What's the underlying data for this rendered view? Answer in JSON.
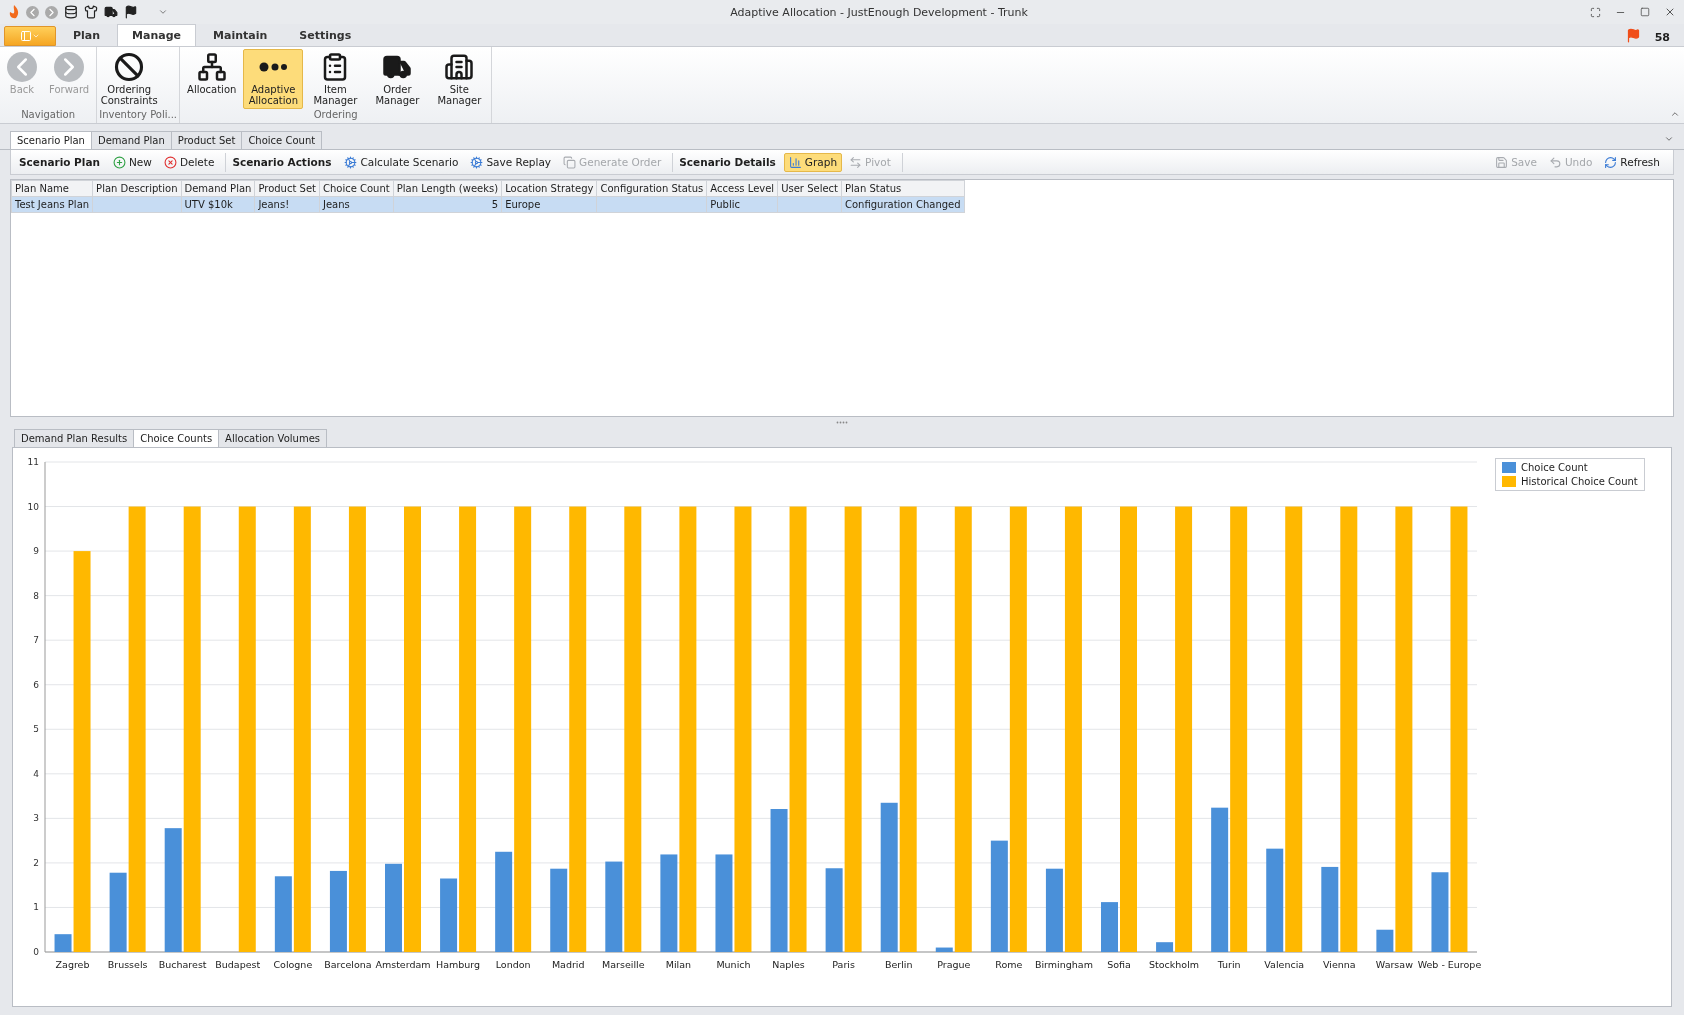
{
  "window": {
    "title": "Adaptive Allocation - JustEnough Development - Trunk"
  },
  "ribbon": {
    "tabs": [
      {
        "label": "Plan",
        "selected": false
      },
      {
        "label": "Manage",
        "selected": true
      },
      {
        "label": "Maintain",
        "selected": false
      },
      {
        "label": "Settings",
        "selected": false
      }
    ],
    "notification_count": "58",
    "groups": [
      {
        "label": "Navigation",
        "buttons": [
          {
            "label": "Back",
            "kind": "back",
            "disabled": true,
            "selected": false
          },
          {
            "label": "Forward",
            "kind": "forward",
            "disabled": true,
            "selected": false
          }
        ]
      },
      {
        "label": "Inventory Poli...",
        "buttons": [
          {
            "label": "Ordering Constraints",
            "kind": "ban",
            "disabled": false,
            "selected": false
          }
        ]
      },
      {
        "label": "Ordering",
        "buttons": [
          {
            "label": "Allocation",
            "kind": "tree",
            "disabled": false,
            "selected": false
          },
          {
            "label": "Adaptive Allocation",
            "kind": "dots",
            "disabled": false,
            "selected": true
          },
          {
            "label": "Item Manager",
            "kind": "notepad",
            "disabled": false,
            "selected": false
          },
          {
            "label": "Order Manager",
            "kind": "truck",
            "disabled": false,
            "selected": false
          },
          {
            "label": "Site Manager",
            "kind": "building",
            "disabled": false,
            "selected": false
          }
        ]
      }
    ]
  },
  "document_tabs": [
    {
      "label": "Scenario Plan",
      "selected": true
    },
    {
      "label": "Demand Plan",
      "selected": false
    },
    {
      "label": "Product Set",
      "selected": false
    },
    {
      "label": "Choice Count",
      "selected": false
    }
  ],
  "toolbar": {
    "groups": [
      {
        "heading": "Scenario Plan",
        "buttons": [
          {
            "label": "New",
            "kind": "plus",
            "disabled": false,
            "selected": false
          },
          {
            "label": "Delete",
            "kind": "delete",
            "disabled": false,
            "selected": false
          }
        ]
      },
      {
        "heading": "Scenario Actions",
        "buttons": [
          {
            "label": "Calculate Scenario",
            "kind": "gears",
            "disabled": false,
            "selected": false
          },
          {
            "label": "Save Replay",
            "kind": "gears",
            "disabled": false,
            "selected": false
          },
          {
            "label": "Generate Order",
            "kind": "copy",
            "disabled": true,
            "selected": false
          }
        ]
      },
      {
        "heading": "Scenario Details",
        "buttons": [
          {
            "label": "Graph",
            "kind": "chart",
            "disabled": false,
            "selected": true
          },
          {
            "label": "Pivot",
            "kind": "swap",
            "disabled": true,
            "selected": false
          }
        ]
      }
    ],
    "right_buttons": [
      {
        "label": "Save",
        "kind": "save",
        "disabled": true,
        "selected": false
      },
      {
        "label": "Undo",
        "kind": "undo",
        "disabled": true,
        "selected": false
      },
      {
        "label": "Refresh",
        "kind": "refresh",
        "disabled": false,
        "selected": false
      }
    ]
  },
  "table": {
    "columns": [
      "Plan Name",
      "Plan Description",
      "Demand Plan",
      "Product Set",
      "Choice Count",
      "Plan Length (weeks)",
      "Location Strategy",
      "Configuration Status",
      "Access Level",
      "User Select",
      "Plan Status"
    ],
    "rows": [
      {
        "selected": true,
        "cells": [
          "Test Jeans Plan",
          "",
          "UTV $10k",
          "Jeans!",
          "Jeans",
          "5",
          "Europe",
          "",
          "Public",
          "",
          "Configuration Changed"
        ]
      }
    ]
  },
  "result_tabs": [
    {
      "label": "Demand Plan Results",
      "selected": false
    },
    {
      "label": "Choice Counts",
      "selected": true
    },
    {
      "label": "Allocation Volumes",
      "selected": false
    }
  ],
  "chart_data": {
    "type": "bar",
    "grid": true,
    "categories": [
      "Zagreb",
      "Brussels",
      "Bucharest",
      "Budapest",
      "Cologne",
      "Barcelona",
      "Amsterdam",
      "Hamburg",
      "London",
      "Madrid",
      "Marseille",
      "Milan",
      "Munich",
      "Naples",
      "Paris",
      "Berlin",
      "Prague",
      "Rome",
      "Birmingham",
      "Sofia",
      "Stockholm",
      "Turin",
      "Valencia",
      "Vienna",
      "Warsaw",
      "Web - Europe"
    ],
    "series": [
      {
        "name": "Choice Count",
        "color": "#4a90d9",
        "values": [
          0.4,
          1.78,
          2.78,
          0,
          1.7,
          1.82,
          1.98,
          1.65,
          2.25,
          1.87,
          2.03,
          2.19,
          2.19,
          3.21,
          1.88,
          3.35,
          0.1,
          2.5,
          1.87,
          1.12,
          0.22,
          3.24,
          2.32,
          1.91,
          0.5,
          1.79
        ]
      },
      {
        "name": "Historical Choice Count",
        "color": "#ffb800",
        "values": [
          9,
          10,
          10,
          10,
          10,
          10,
          10,
          10,
          10,
          10,
          10,
          10,
          10,
          10,
          10,
          10,
          10,
          10,
          10,
          10,
          10,
          10,
          10,
          10,
          10,
          10
        ]
      }
    ],
    "ylim": [
      0,
      11
    ],
    "yticks": [
      0,
      1,
      2,
      3,
      4,
      5,
      6,
      7,
      8,
      9,
      10,
      11
    ]
  }
}
